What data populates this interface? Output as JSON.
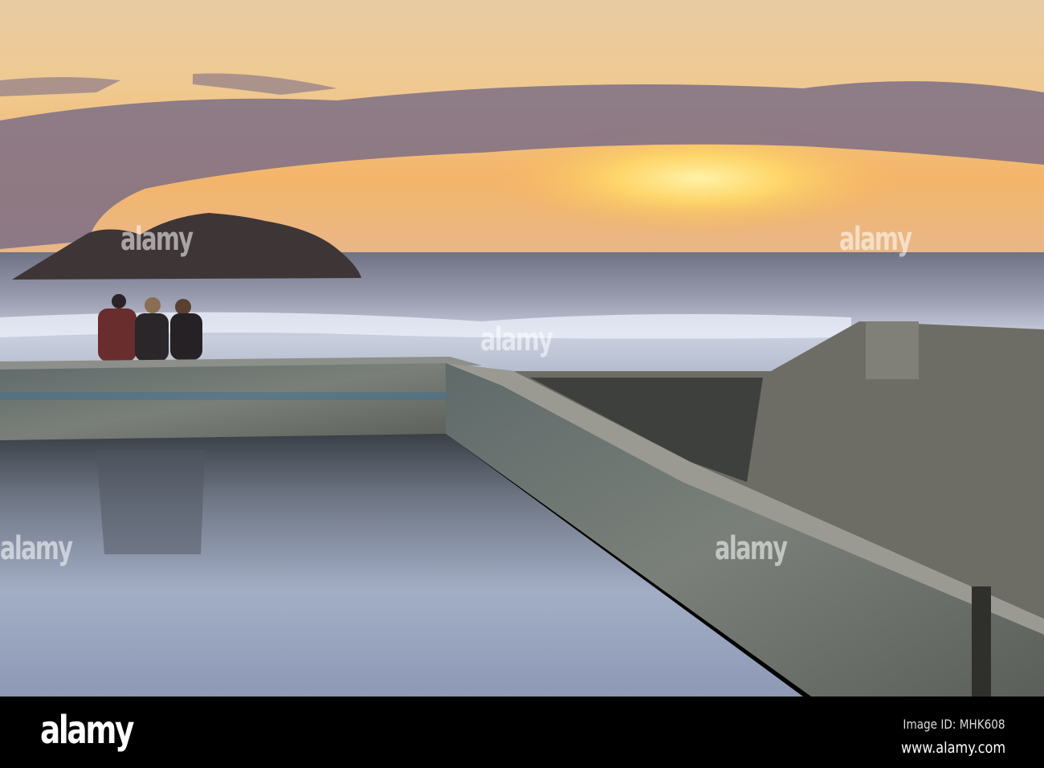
{
  "watermark": "alamy",
  "footer": {
    "logo": "alamy",
    "image_id": "Image ID: MHK608",
    "url": "www.alamy.com"
  },
  "colors": {
    "sky_top": "#eccfa6",
    "sun": "#ffe680",
    "clouds": "#7c6f86",
    "sea": "#8c93a8",
    "pool": "#8f9bb3",
    "concrete": "#6f756f"
  }
}
